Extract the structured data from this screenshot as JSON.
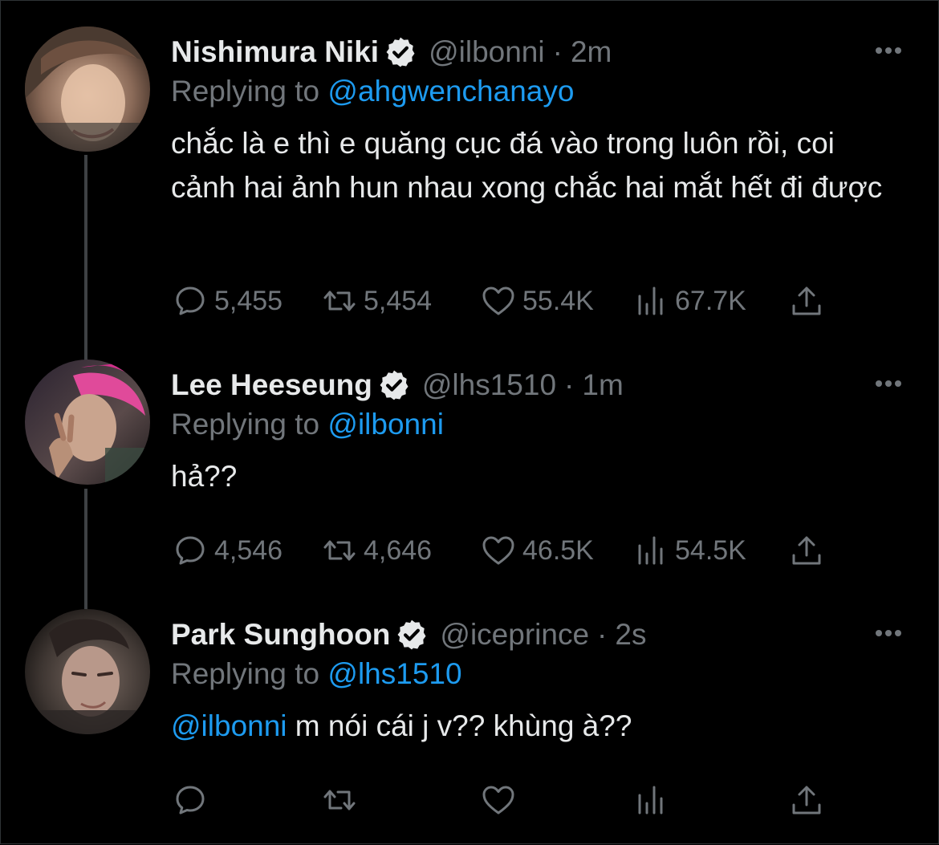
{
  "tweets": [
    {
      "name": "Nishimura Niki",
      "handle": "@ilbonni",
      "separator": "·",
      "time": "2m",
      "replying_prefix": "Replying to ",
      "replying_to": "@ahgwenchanayo",
      "body_mention": "",
      "body": "chắc là e thì e quăng cục đá vào trong luôn rồi, coi cảnh hai ảnh hun nhau xong chắc hai mắt hết đi được",
      "replies": "5,455",
      "retweets": "5,454",
      "likes": "55.4K",
      "views": "67.7K"
    },
    {
      "name": "Lee Heeseung",
      "handle": "@lhs1510",
      "separator": "·",
      "time": "1m",
      "replying_prefix": "Replying to ",
      "replying_to": "@ilbonni",
      "body_mention": "",
      "body": "hả??",
      "replies": "4,546",
      "retweets": "4,646",
      "likes": "46.5K",
      "views": "54.5K"
    },
    {
      "name": "Park Sunghoon",
      "handle": "@iceprince",
      "separator": "·",
      "time": "2s",
      "replying_prefix": "Replying to ",
      "replying_to": "@lhs1510",
      "body_mention": "@ilbonni",
      "body": " m nói cái j v?? khùng à??",
      "replies": "",
      "retweets": "",
      "likes": "",
      "views": ""
    }
  ],
  "icons": {
    "verified": "verified-badge-icon",
    "more": "more-dots-icon",
    "reply": "reply-bubble-icon",
    "retweet": "retweet-icon",
    "like": "heart-icon",
    "views": "views-bar-chart-icon",
    "share": "share-upload-icon"
  },
  "colors": {
    "background": "#000000",
    "text": "#e7e9ea",
    "muted": "#71767b",
    "link": "#1d9bf0"
  }
}
